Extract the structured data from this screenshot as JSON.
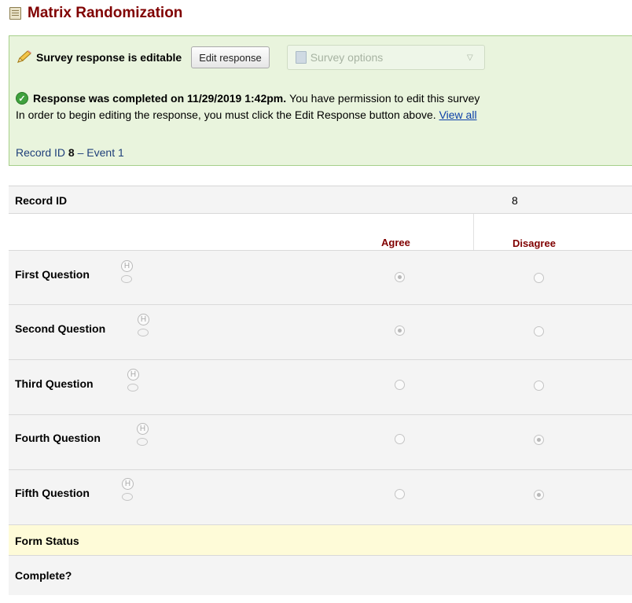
{
  "header": {
    "title": "Matrix Randomization",
    "icon": "form-icon"
  },
  "survey_bar": {
    "editable_text": "Survey response is editable",
    "edit_button": "Edit response",
    "survey_options_label": "Survey options"
  },
  "status": {
    "completed_bold": "Response was completed on 11/29/2019 1:42pm.",
    "permission_text": "You have permission to edit this survey",
    "instructions": "In order to begin editing the response, you must click the Edit Response button above.",
    "view_all_link": "View all"
  },
  "record_line": {
    "prefix": "Record ID",
    "id": "8",
    "event": "– Event 1"
  },
  "form": {
    "record_id_label": "Record ID",
    "record_id_value": "8",
    "matrix_headers": [
      "Agree",
      "Disagree"
    ],
    "questions": [
      {
        "label": "First Question",
        "selected": "Agree"
      },
      {
        "label": "Second Question",
        "selected": "Agree"
      },
      {
        "label": "Third Question",
        "selected": ""
      },
      {
        "label": "Fourth Question",
        "selected": "Disagree"
      },
      {
        "label": "Fifth Question",
        "selected": "Disagree"
      }
    ],
    "form_status_label": "Form Status",
    "complete_label": "Complete?"
  },
  "colors": {
    "title": "#800000",
    "info_bg": "#e9f4dd",
    "info_border": "#a6cf8a",
    "form_status_bg": "#fefbd8"
  }
}
